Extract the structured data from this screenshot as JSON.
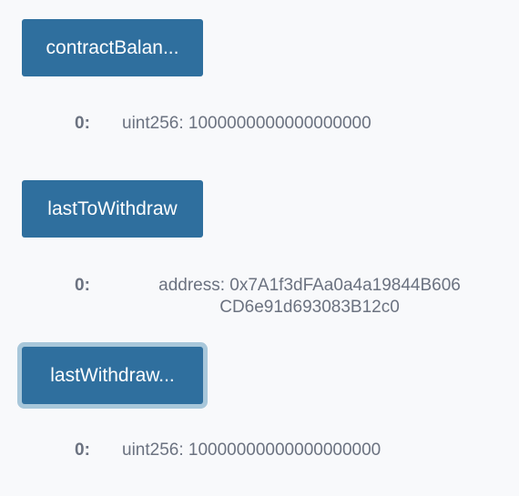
{
  "functions": [
    {
      "button_label": "contractBalan...",
      "outputs": [
        {
          "index": "0:",
          "value": "uint256: 1000000000000000000"
        }
      ]
    },
    {
      "button_label": "lastToWithdraw",
      "outputs": [
        {
          "index": "0:",
          "value_line1": "address: 0x7A1f3dFAa0a4a19844B606",
          "value_line2": "CD6e91d693083B12c0"
        }
      ]
    },
    {
      "button_label": "lastWithdraw...",
      "focused": true,
      "outputs": [
        {
          "index": "0:",
          "value": "uint256: 10000000000000000000"
        }
      ]
    }
  ],
  "colors": {
    "button_bg": "#2f6f9e",
    "button_text": "#ffffff",
    "focus_ring": "#a8c7da",
    "result_text": "#6b7280",
    "page_bg": "#f8f9fb"
  }
}
